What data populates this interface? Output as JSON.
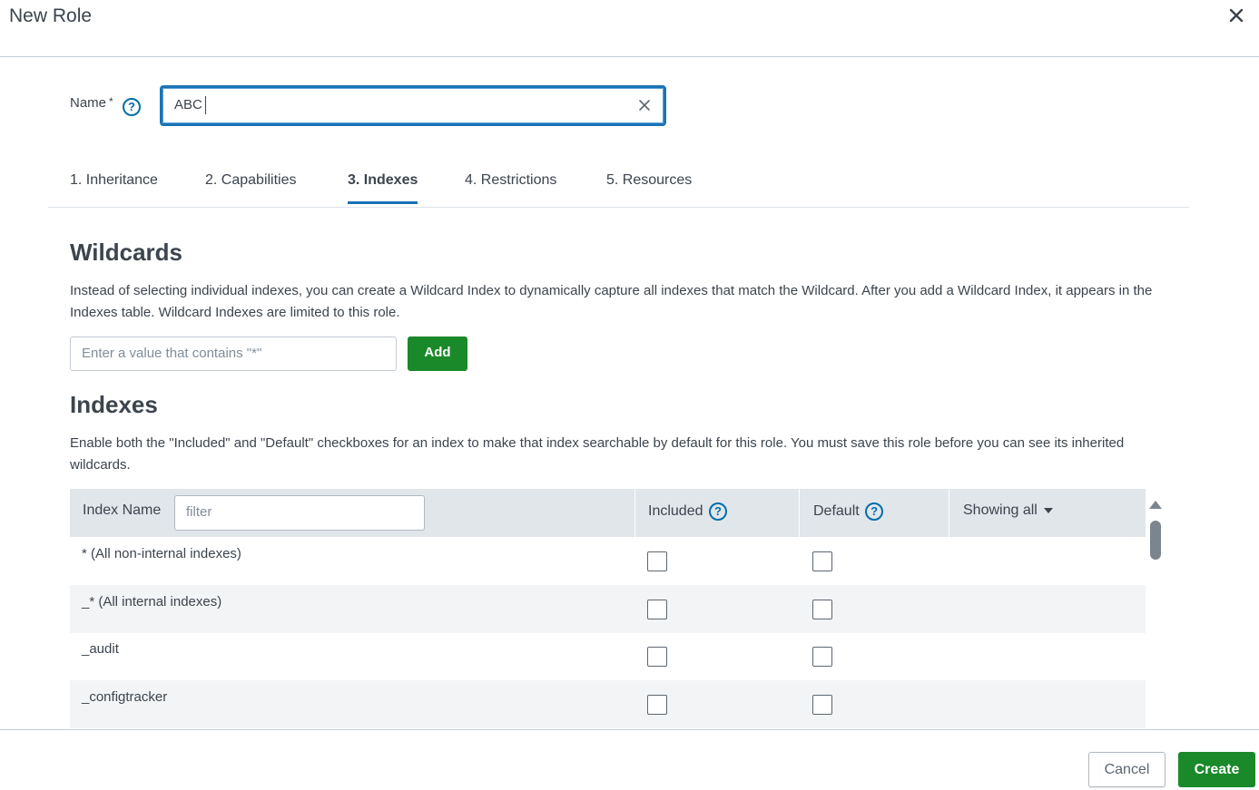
{
  "dialog": {
    "title": "New Role",
    "close_icon": "close-icon"
  },
  "name_field": {
    "label": "Name",
    "required_mark": "*",
    "help": "?",
    "value": "ABC"
  },
  "tabs": [
    {
      "label": "1. Inheritance",
      "active": false
    },
    {
      "label": "2. Capabilities",
      "active": false
    },
    {
      "label": "3. Indexes",
      "active": true
    },
    {
      "label": "4. Restrictions",
      "active": false
    },
    {
      "label": "5. Resources",
      "active": false
    }
  ],
  "wildcards": {
    "heading": "Wildcards",
    "description": "Instead of selecting individual indexes, you can create a Wildcard Index to dynamically capture all indexes that match the Wildcard. After you add a Wildcard Index, it appears in the Indexes table. Wildcard Indexes are limited to this role.",
    "input_placeholder": "Enter a value that contains \"*\"",
    "add_label": "Add"
  },
  "indexes": {
    "heading": "Indexes",
    "description": "Enable both the \"Included\" and \"Default\" checkboxes for an index to make that index searchable by default for this role. You must save this role before you can see its inherited wildcards.",
    "columns": {
      "index_name": "Index Name",
      "filter_placeholder": "filter",
      "included": "Included",
      "default": "Default",
      "showing": "Showing all",
      "help": "?"
    },
    "rows": [
      {
        "name": "* (All non-internal indexes)",
        "included": false,
        "default": false
      },
      {
        "name": "_* (All internal indexes)",
        "included": false,
        "default": false
      },
      {
        "name": "_audit",
        "included": false,
        "default": false
      },
      {
        "name": "_configtracker",
        "included": false,
        "default": false
      }
    ]
  },
  "footer": {
    "cancel_label": "Cancel",
    "create_label": "Create"
  },
  "colors": {
    "accent_blue": "#1a73b6",
    "primary_green": "#1a8929",
    "header_gray": "#e1e6eb"
  }
}
